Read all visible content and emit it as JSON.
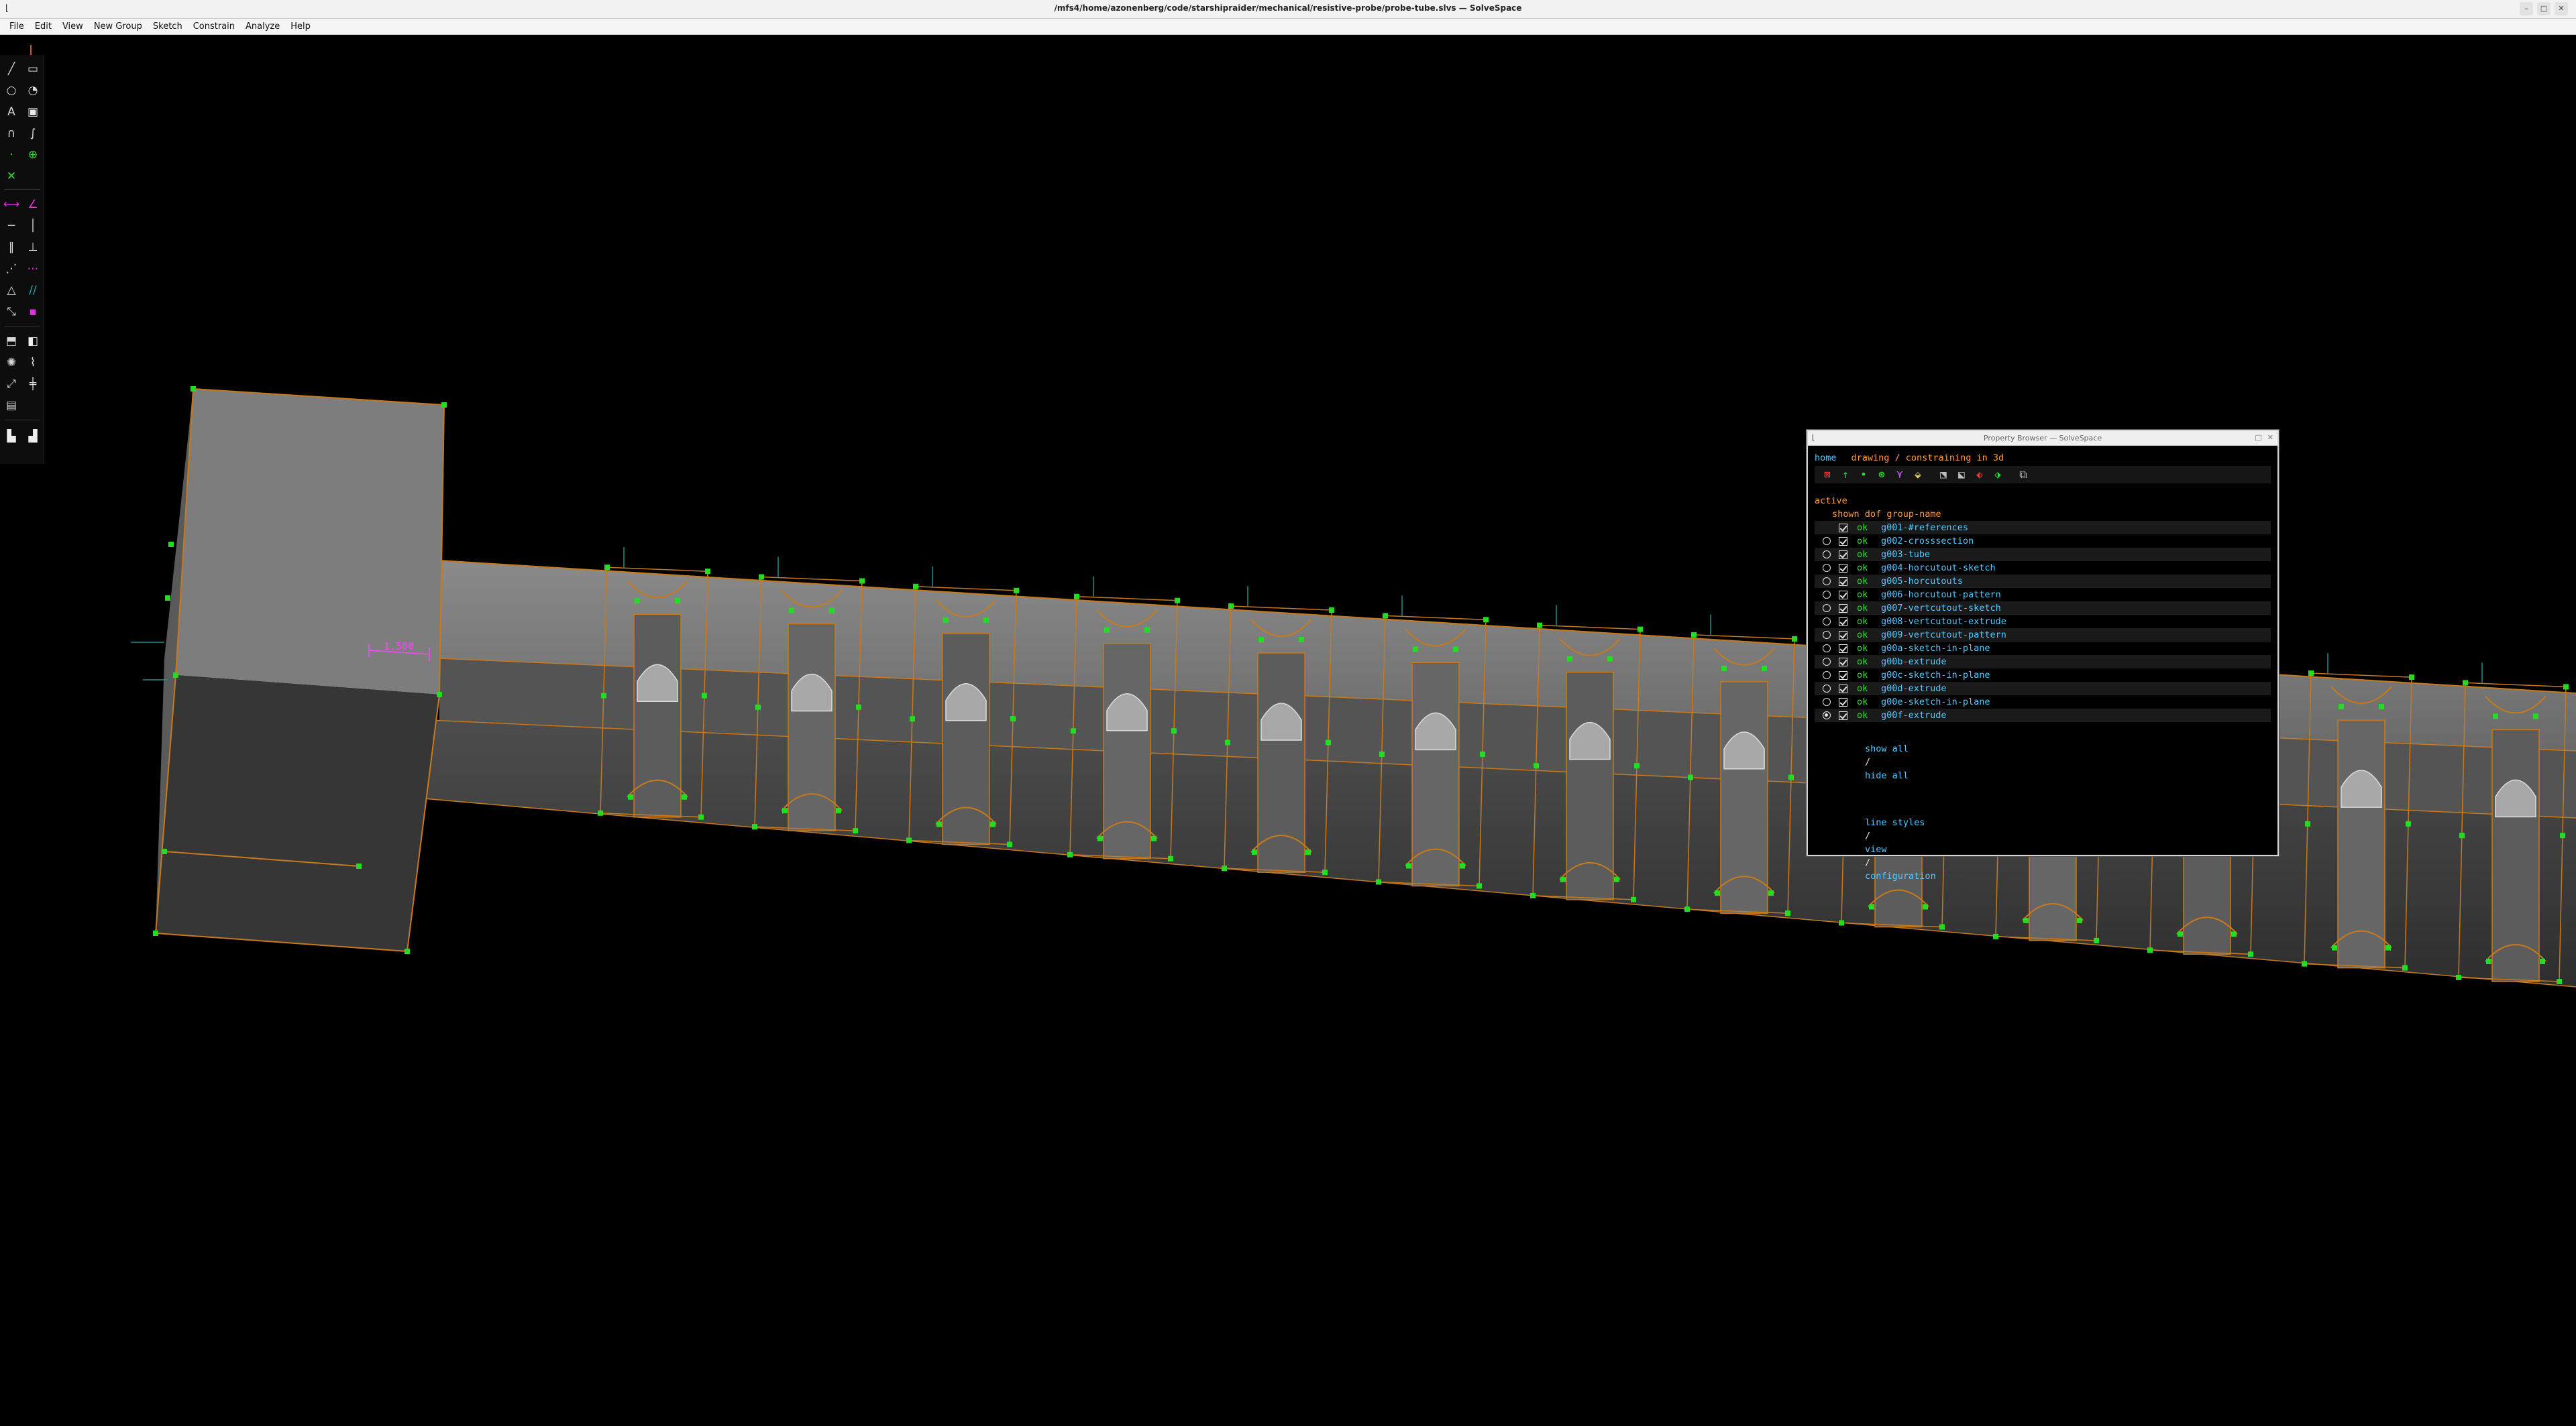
{
  "window": {
    "title": "/mfs4/home/azonenberg/code/starshipraider/mechanical/resistive-probe/probe-tube.slvs — SolveSpace",
    "app_icon": "solvespace-icon",
    "buttons": [
      "minimize",
      "maximize",
      "close"
    ]
  },
  "menubar": {
    "items": [
      "File",
      "Edit",
      "View",
      "New Group",
      "Sketch",
      "Constrain",
      "Analyze",
      "Help"
    ]
  },
  "viewport": {
    "dimension_label": "1.500",
    "colors": {
      "background": "#000000",
      "surface": "#7a7a7a",
      "edge": "#c87a1a",
      "point": "#22dd22",
      "dimension": "#ff44ff",
      "normal": "#2a8a8a"
    }
  },
  "toolbar": {
    "tools": [
      "line-icon",
      "rectangle-icon",
      "circle-icon",
      "arc-icon",
      "text-icon",
      "image-icon",
      "tangent-arc-icon",
      "bezier-icon",
      "point-icon",
      "workplane-icon",
      "split-curves-icon",
      "distance-icon",
      "angle-icon",
      "horizontal-icon",
      "vertical-icon",
      "parallel-icon",
      "perpendicular-icon",
      "point-on-line-icon",
      "symmetric-icon",
      "equal-icon",
      "other-supplement-icon",
      "nearest-iso-icon",
      "ref-icon",
      "extrude-icon",
      "lathe-icon",
      "revolve-icon",
      "helix-icon",
      "step-translate-icon",
      "step-rotate-icon",
      "in-3d-icon",
      "workplane-plane-icon",
      "assemble-icon",
      "sketch-in-new-workplane-icon"
    ]
  },
  "property_browser": {
    "title": "Property Browser — SolveSpace",
    "nav": {
      "home": "home",
      "context": "drawing / constraining in 3d"
    },
    "icons": [
      "workplanes-icon",
      "normals-icon",
      "points-icon",
      "constraints-icon",
      "faces-icon",
      "construction-icon",
      "surfaces-icon",
      "edges-icon",
      "outlines-icon",
      "mesh-icon",
      "hidden-lines-icon",
      "ortho-icon"
    ],
    "active_label": "active",
    "columns": {
      "shown": "shown",
      "dof": "dof",
      "name": "group-name"
    },
    "groups": [
      {
        "radio": "none",
        "shown": true,
        "dof": "ok",
        "name": "g001-#references"
      },
      {
        "radio": "off",
        "shown": true,
        "dof": "ok",
        "name": "g002-crosssection"
      },
      {
        "radio": "off",
        "shown": true,
        "dof": "ok",
        "name": "g003-tube"
      },
      {
        "radio": "off",
        "shown": true,
        "dof": "ok",
        "name": "g004-horcutout-sketch"
      },
      {
        "radio": "off",
        "shown": true,
        "dof": "ok",
        "name": "g005-horcutouts"
      },
      {
        "radio": "off",
        "shown": true,
        "dof": "ok",
        "name": "g006-horcutout-pattern"
      },
      {
        "radio": "off",
        "shown": true,
        "dof": "ok",
        "name": "g007-vertcutout-sketch"
      },
      {
        "radio": "off",
        "shown": true,
        "dof": "ok",
        "name": "g008-vertcutout-extrude"
      },
      {
        "radio": "off",
        "shown": true,
        "dof": "ok",
        "name": "g009-vertcutout-pattern"
      },
      {
        "radio": "off",
        "shown": true,
        "dof": "ok",
        "name": "g00a-sketch-in-plane"
      },
      {
        "radio": "off",
        "shown": true,
        "dof": "ok",
        "name": "g00b-extrude"
      },
      {
        "radio": "off",
        "shown": true,
        "dof": "ok",
        "name": "g00c-sketch-in-plane"
      },
      {
        "radio": "off",
        "shown": true,
        "dof": "ok",
        "name": "g00d-extrude"
      },
      {
        "radio": "off",
        "shown": true,
        "dof": "ok",
        "name": "g00e-sketch-in-plane"
      },
      {
        "radio": "on",
        "shown": true,
        "dof": "ok",
        "name": "g00f-extrude"
      }
    ],
    "show_all": "show all",
    "sep": "/",
    "hide_all": "hide all",
    "links": {
      "line_styles": "line styles",
      "view": "view",
      "configuration": "configuration"
    }
  }
}
